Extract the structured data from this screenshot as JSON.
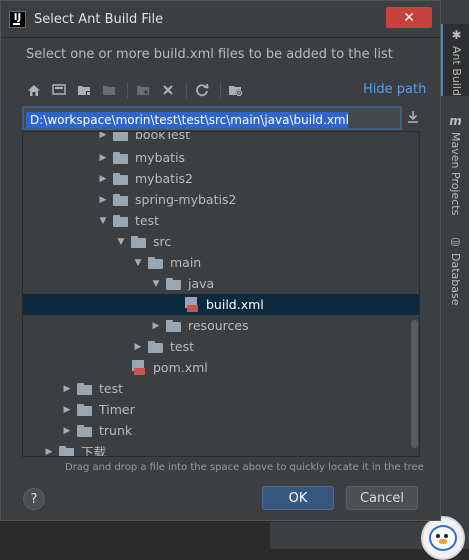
{
  "dialog": {
    "title": "Select Ant Build File",
    "app_icon_text": "IJ",
    "close_symbol": "✕",
    "prompt": "Select one or more build.xml files to be added to the list",
    "hide_path_label": "Hide path",
    "path_value": "D:\\workspace\\morin\\test\\test\\src\\main\\java\\build.xml",
    "hint": "Drag and drop a file into the space above to quickly locate it in the tree",
    "help_label": "?",
    "ok_label": "OK",
    "cancel_label": "Cancel"
  },
  "toolbar": {
    "icons": [
      "home-icon",
      "desktop-icon",
      "project-folder-icon",
      "module-folder-icon",
      "new-folder-icon",
      "delete-icon",
      "refresh-icon",
      "show-hidden-icon"
    ]
  },
  "tree": {
    "rows": [
      {
        "label": "bookTest",
        "type": "folder",
        "expanded": false
      },
      {
        "label": "mybatis",
        "type": "folder",
        "expanded": false
      },
      {
        "label": "mybatis2",
        "type": "folder",
        "expanded": false
      },
      {
        "label": "spring-mybatis2",
        "type": "folder",
        "expanded": false
      },
      {
        "label": "test",
        "type": "folder",
        "expanded": true
      },
      {
        "label": "src",
        "type": "folder",
        "expanded": true
      },
      {
        "label": "main",
        "type": "folder",
        "expanded": true
      },
      {
        "label": "java",
        "type": "folder",
        "expanded": true
      },
      {
        "label": "build.xml",
        "type": "ant-file",
        "selected": true
      },
      {
        "label": "resources",
        "type": "folder",
        "expanded": false
      },
      {
        "label": "test",
        "type": "folder",
        "expanded": false
      },
      {
        "label": "pom.xml",
        "type": "maven-file"
      },
      {
        "label": "test",
        "type": "folder",
        "expanded": false
      },
      {
        "label": "Timer",
        "type": "folder",
        "expanded": false
      },
      {
        "label": "trunk",
        "type": "folder",
        "expanded": false
      },
      {
        "label": "下载",
        "type": "folder",
        "expanded": false
      }
    ]
  },
  "ide_sidebar": {
    "tabs": [
      {
        "label": "Ant Build",
        "icon": "ant-icon",
        "active": true
      },
      {
        "label": "Maven Projects",
        "icon": "maven-icon",
        "active": false
      },
      {
        "label": "Database",
        "icon": "database-icon",
        "active": false
      }
    ]
  },
  "colors": {
    "accent": "#365880",
    "selection": "#0d293e",
    "path_highlight": "#2f65ca",
    "close": "#c7423c",
    "link": "#589df6"
  }
}
